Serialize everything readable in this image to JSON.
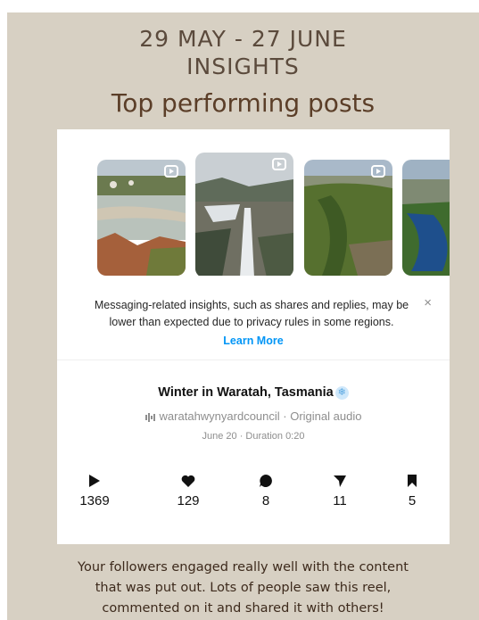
{
  "header": {
    "date_range": "29 MAY - 27 JUNE",
    "subtitle": "INSIGHTS",
    "section_title": "Top performing posts"
  },
  "notice": {
    "text": "Messaging-related insights, such as shares and replies, may be lower than expected due to privacy rules in some regions.",
    "link": "Learn More",
    "close": "×"
  },
  "post": {
    "title": "Winter in Waratah, Tasmania",
    "snow_icon": "❄",
    "audio": "waratahwynyardcouncil · Original audio",
    "meta": "June 20 · Duration 0:20"
  },
  "stats": {
    "plays": "1369",
    "likes": "129",
    "comments": "8",
    "shares": "11",
    "saves": "5"
  },
  "footer": {
    "line1": "Your followers engaged really well with the content",
    "line2": "that was put out. Lots of people saw this reel,",
    "line3": "commented on it and shared it with others!"
  },
  "colors": {
    "background": "#d7d0c3",
    "title_brown": "#5b3e28",
    "link_blue": "#0095f6"
  },
  "icons": [
    "reel-icon",
    "close-icon",
    "snowflake-icon",
    "audio-wave-icon",
    "play-icon",
    "heart-icon",
    "comment-icon",
    "share-icon",
    "bookmark-icon"
  ]
}
